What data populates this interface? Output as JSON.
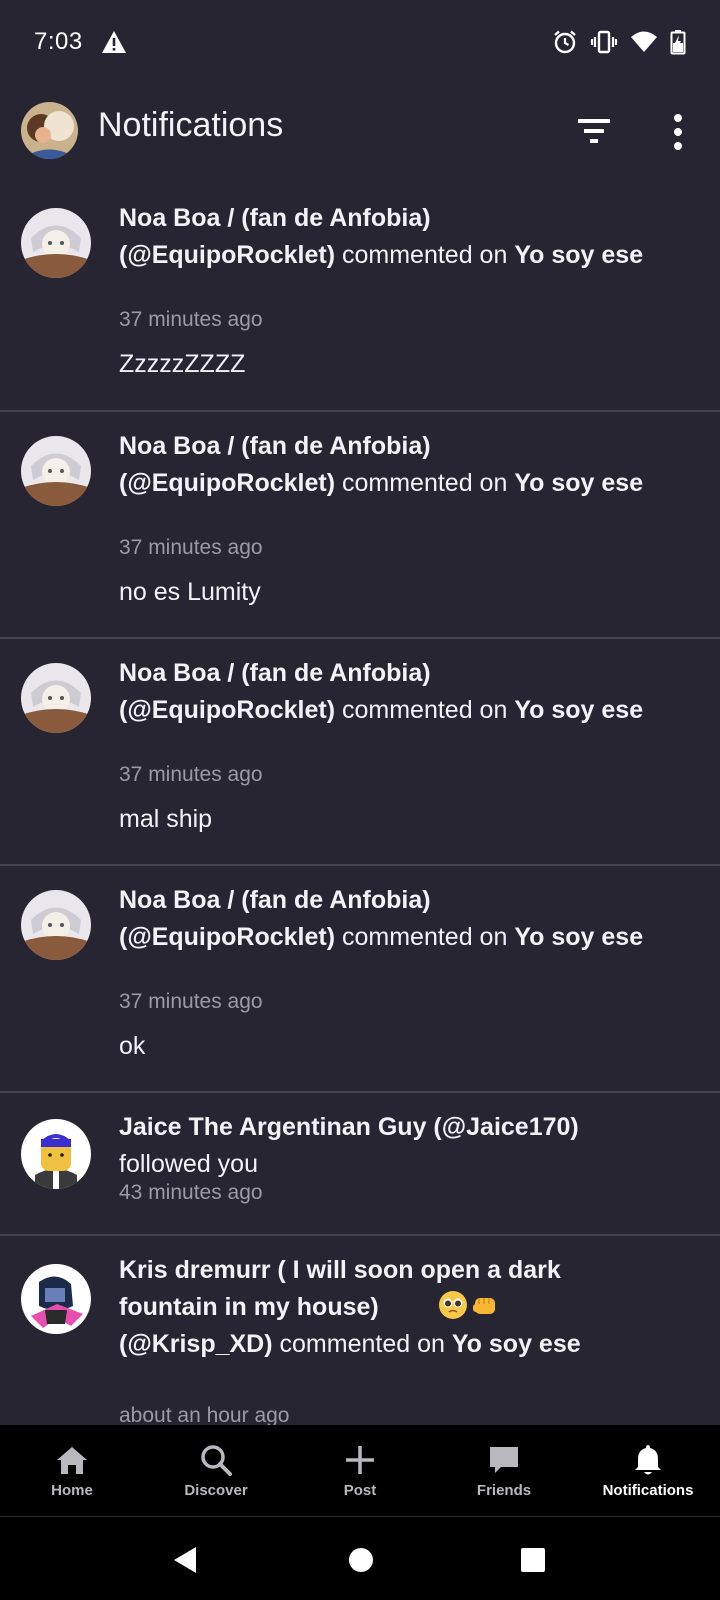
{
  "status_bar": {
    "time": "7:03",
    "icons": [
      "warning-icon",
      "alarm-icon",
      "vibrate-icon",
      "wifi-icon",
      "battery-icon"
    ]
  },
  "header": {
    "title": "Notifications",
    "icons": [
      "filter-icon",
      "more-vert-icon"
    ]
  },
  "notifications": [
    {
      "user": "Noa Boa / (fan de Anfobia)",
      "handle": "(@EquipoRocklet)",
      "action": "commented on",
      "target": "Yo soy ese",
      "time": "37 minutes ago",
      "comment": "ZzzzzZZZZ"
    },
    {
      "user": "Noa Boa / (fan de Anfobia)",
      "handle": "(@EquipoRocklet)",
      "action": "commented on",
      "target": "Yo soy ese",
      "time": "37 minutes ago",
      "comment": "no es Lumity"
    },
    {
      "user": "Noa Boa / (fan de Anfobia)",
      "handle": "(@EquipoRocklet)",
      "action": "commented on",
      "target": "Yo soy ese",
      "time": "37 minutes ago",
      "comment": "mal ship"
    },
    {
      "user": "Noa Boa / (fan de Anfobia)",
      "handle": "(@EquipoRocklet)",
      "action": "commented on",
      "target": "Yo soy ese",
      "time": "37 minutes ago",
      "comment": "ok"
    },
    {
      "user": "Jaice The Argentinan Guy (@Jaice170)",
      "action": "followed you",
      "time": "43 minutes ago"
    },
    {
      "user_line1": "Kris dremurr ( I will soon open a dark",
      "user_line2": "fountain in my house)",
      "emojis": [
        "pleading-face-emoji",
        "fist-emoji"
      ],
      "handle": "(@Krisp_XD)",
      "action": "commented on",
      "target": "Yo soy ese",
      "time": "about an hour ago"
    }
  ],
  "bottom_nav": [
    {
      "label": "Home",
      "icon": "home-icon",
      "active": false
    },
    {
      "label": "Discover",
      "icon": "search-icon",
      "active": false
    },
    {
      "label": "Post",
      "icon": "plus-icon",
      "active": false
    },
    {
      "label": "Friends",
      "icon": "chat-icon",
      "active": false
    },
    {
      "label": "Notifications",
      "icon": "bell-icon",
      "active": true
    }
  ],
  "system_nav": [
    "back-icon",
    "home-circle-icon",
    "recents-icon"
  ],
  "colors": {
    "background": "#272531",
    "divider": "#45434e",
    "text": "#f3f2f6",
    "secondary_text": "#9c9aa5",
    "nav_background": "#000000"
  }
}
